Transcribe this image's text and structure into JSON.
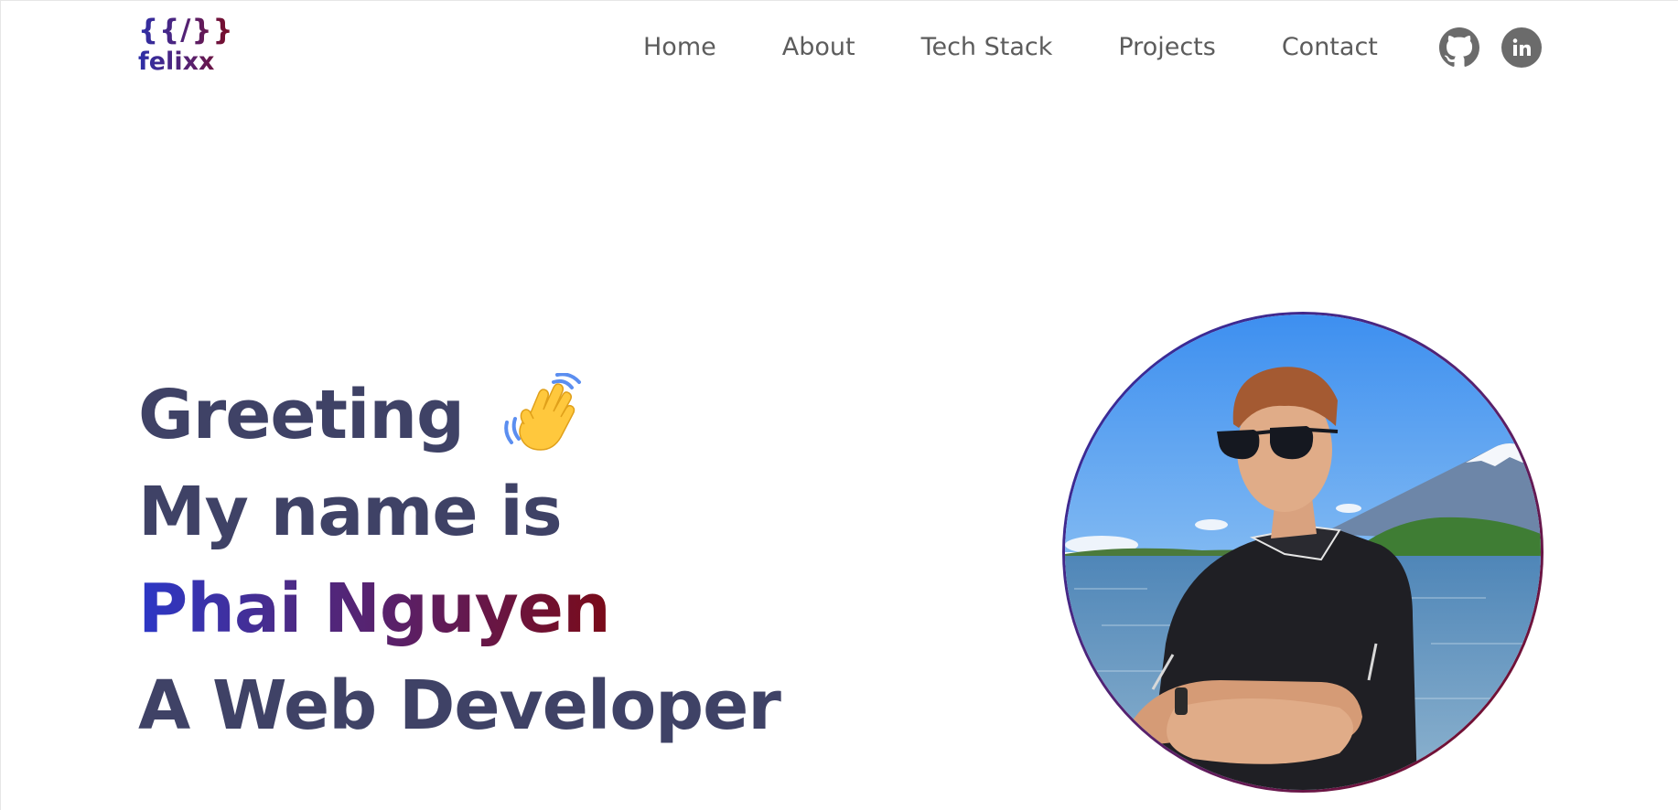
{
  "header": {
    "logo_mark": "{{/}}",
    "logo_text": "felixx",
    "nav": [
      {
        "label": "Home"
      },
      {
        "label": "About"
      },
      {
        "label": "Tech Stack"
      },
      {
        "label": "Projects"
      },
      {
        "label": "Contact"
      }
    ],
    "socials": [
      {
        "icon": "github-icon"
      },
      {
        "icon": "linkedin-icon"
      }
    ]
  },
  "hero": {
    "line1": "Greeting",
    "line1_emoji": "waving-hand-icon",
    "line2": "My name is",
    "name": "Phai Nguyen",
    "line4": "A Web Developer"
  },
  "colors": {
    "text": "#3f4266",
    "nav": "#5c5c5c",
    "gradient_start": "#2b37c7",
    "gradient_mid": "#5a2068",
    "gradient_end": "#7a0a18"
  },
  "avatar": {
    "icon": "profile-photo"
  }
}
